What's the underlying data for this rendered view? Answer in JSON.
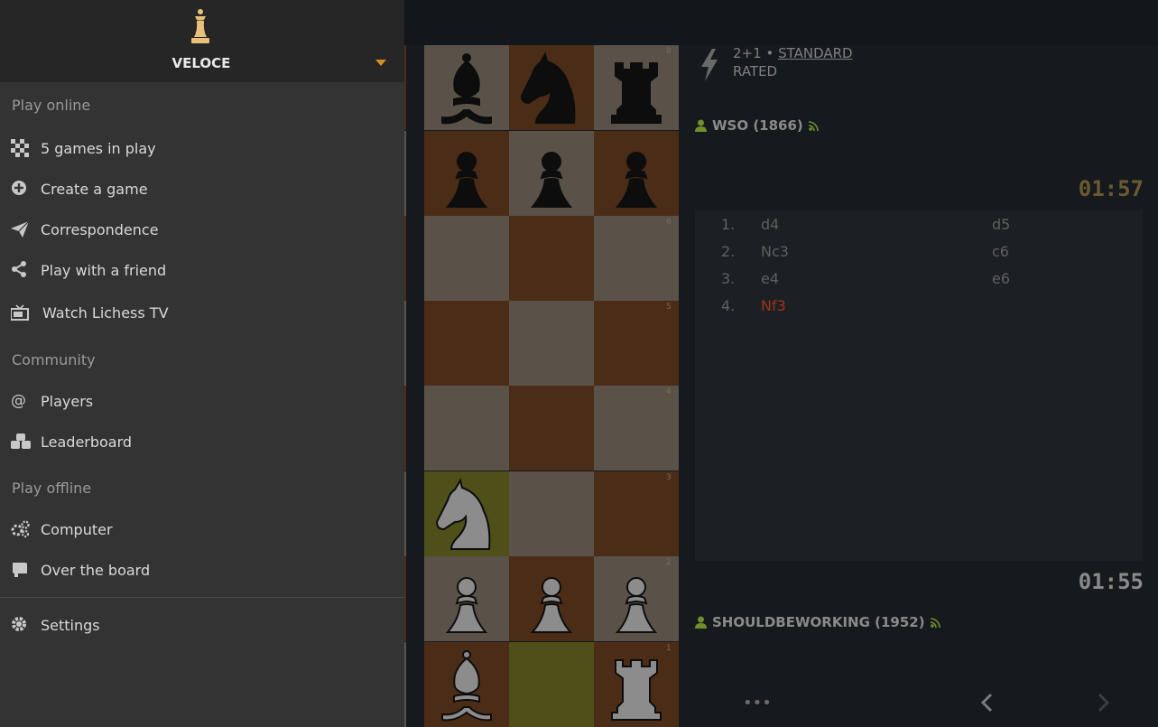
{
  "menu": {
    "username": "VELOCE",
    "sections": [
      {
        "title": "Play online",
        "items": [
          {
            "label": "5 games in play",
            "icon": "checkerboard-icon"
          },
          {
            "label": "Create a game",
            "icon": "plus-circle-icon"
          },
          {
            "label": "Correspondence",
            "icon": "paper-plane-icon"
          },
          {
            "label": "Play with a friend",
            "icon": "share-icon"
          },
          {
            "label": "Watch Lichess TV",
            "icon": "tv-icon"
          }
        ]
      },
      {
        "title": "Community",
        "items": [
          {
            "label": "Players",
            "icon": "at-icon"
          },
          {
            "label": "Leaderboard",
            "icon": "leaderboard-icon"
          }
        ]
      },
      {
        "title": "Play offline",
        "items": [
          {
            "label": "Computer",
            "icon": "gears-icon"
          },
          {
            "label": "Over the board",
            "icon": "board-icon"
          }
        ]
      }
    ],
    "settings": {
      "label": "Settings",
      "icon": "gear-icon"
    }
  },
  "game": {
    "time_control": "2+1",
    "separator": "•",
    "variant": "STANDARD",
    "rated": "RATED",
    "top_player": "WSO (1866)",
    "bottom_player": "SHOULDBEWORKING (1952)",
    "top_clock": "01:57",
    "bottom_clock": "01:55",
    "more_label": "•••",
    "moves": [
      {
        "num": "1.",
        "white": "d4",
        "black": "d5"
      },
      {
        "num": "2.",
        "white": "Nc3",
        "black": "c6"
      },
      {
        "num": "3.",
        "white": "e4",
        "black": "e6"
      },
      {
        "num": "4.",
        "white": "Nf3",
        "black": ""
      }
    ],
    "active_move_color": "#a33214",
    "board_ranks": [
      "8",
      "6",
      "5",
      "4",
      "3",
      "2",
      "1"
    ]
  },
  "colors": {
    "menu_bg": "#333333",
    "menu_header_bg": "#262626",
    "accent": "#d59120",
    "online_green": "#6f8f2a"
  }
}
